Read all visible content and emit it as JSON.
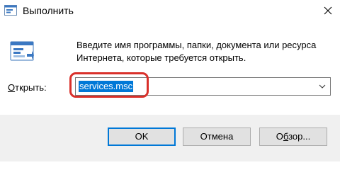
{
  "window": {
    "title": "Выполнить",
    "close_icon": "close-icon",
    "app_icon": "run-icon"
  },
  "description": {
    "line1": "Введите имя программы, папки, документа или ресурса",
    "line2": "Интернета, которые требуется открыть."
  },
  "open": {
    "label_accesskey": "О",
    "label_rest": "ткрыть:",
    "value": "services.msc",
    "dropdown_icon": "chevron-down-icon"
  },
  "buttons": {
    "ok": "OK",
    "cancel": "Отмена",
    "browse_accesskey": "б",
    "browse_prefix": "О",
    "browse_rest": "зор..."
  },
  "colors": {
    "selection": "#0078d7",
    "highlight_ring": "#d9302a",
    "footer_bg": "#f0f0f0"
  }
}
